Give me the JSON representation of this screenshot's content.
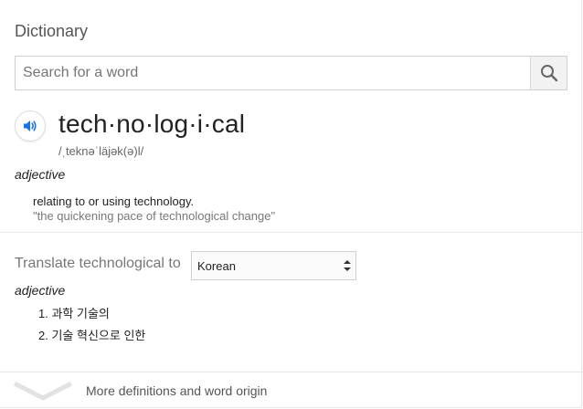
{
  "header": {
    "title": "Dictionary"
  },
  "search": {
    "placeholder": "Search for a word",
    "value": ""
  },
  "entry": {
    "headword": "tech·no·log·i·cal",
    "phonetic": "/ˌteknəˈläjək(ə)l/",
    "part_of_speech": "adjective",
    "definition": "relating to or using technology.",
    "example": "\"the quickening pace of technological change\""
  },
  "translate": {
    "label": "Translate technological to",
    "selected_language": "Korean",
    "part_of_speech": "adjective",
    "items": [
      {
        "number": "1.",
        "text": "과학 기술의"
      },
      {
        "number": "2.",
        "text": "기술 혁신으로 인한"
      }
    ]
  },
  "footer": {
    "more_label": "More definitions and word origin"
  },
  "colors": {
    "accent": "#1a73e8",
    "muted": "#777777"
  },
  "icons": {
    "search": "search-icon",
    "speaker": "speaker-icon",
    "expand": "chevron-down-icon",
    "select": "select-arrows-icon"
  }
}
